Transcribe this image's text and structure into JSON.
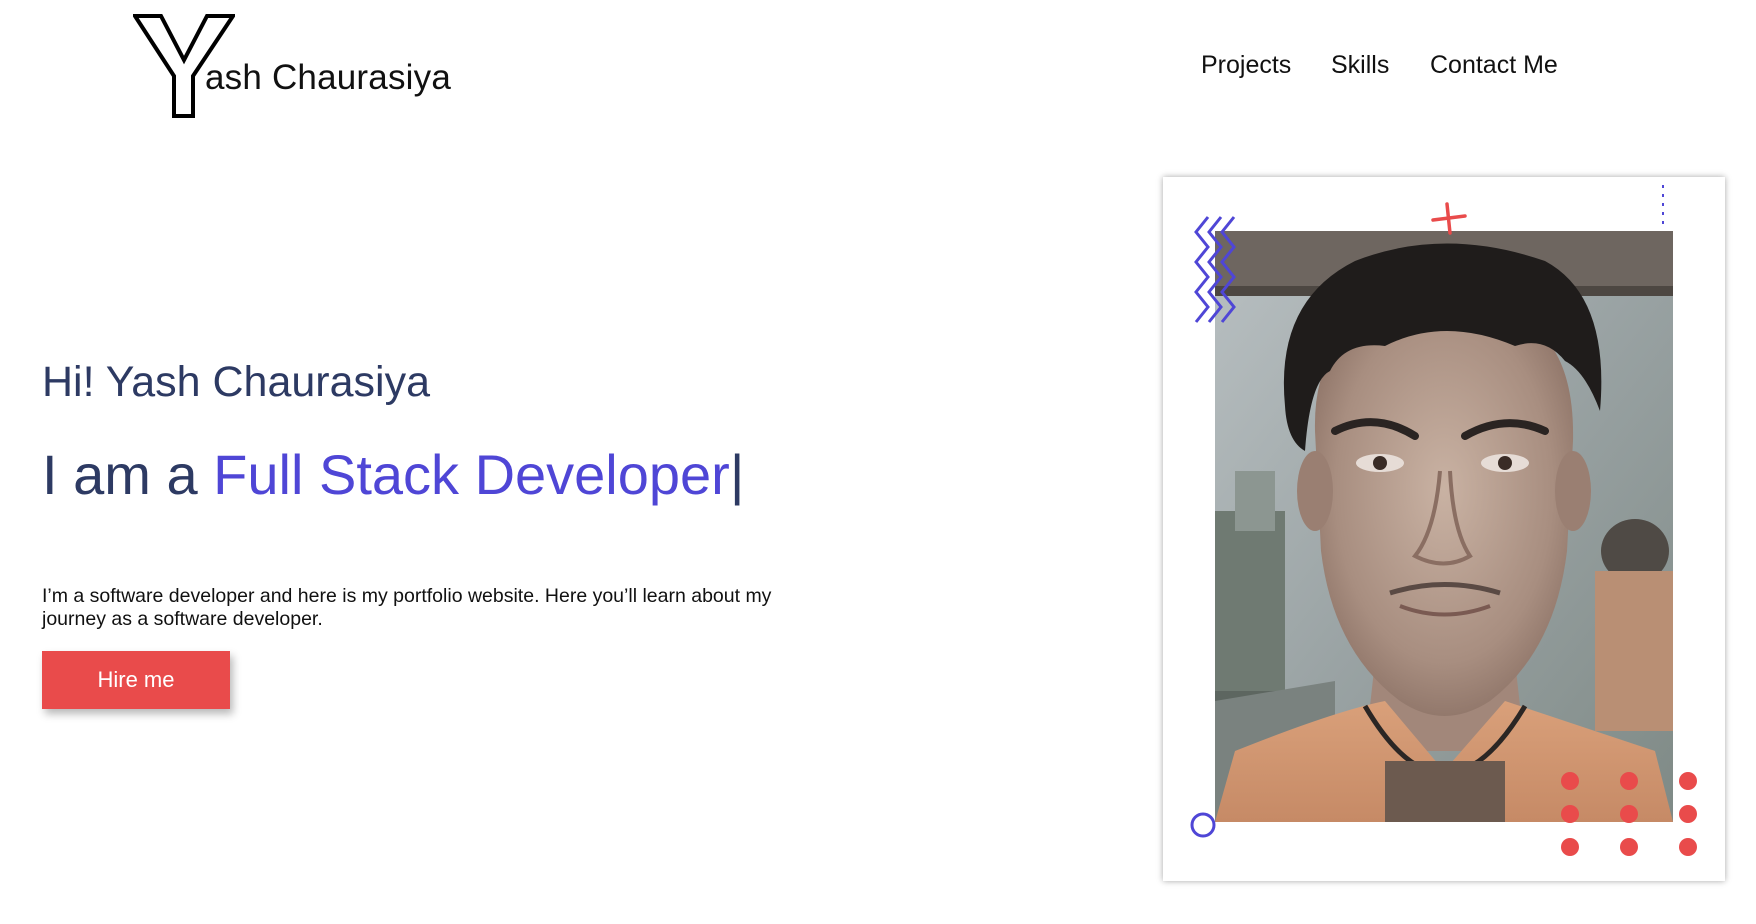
{
  "header": {
    "logo_letter": "Y",
    "logo_text": "ash Chaurasiya",
    "nav": [
      {
        "label": "Projects"
      },
      {
        "label": "Skills"
      },
      {
        "label": "Contact Me"
      }
    ]
  },
  "hero": {
    "greeting": "Hi! Yash Chaurasiya",
    "role_prefix": "I am a ",
    "role_highlight": "Full Stack Developer",
    "cursor": "|",
    "description": "I’m a software developer and here is my portfolio website. Here you’ll learn about my journey as a software developer.",
    "cta_label": "Hire me"
  },
  "colors": {
    "accent": "#4f46d6",
    "heading": "#2d3a63",
    "button": "#e94b4b",
    "decor_red": "#e94b4b"
  },
  "icons": [
    "zigzag-decor-icon",
    "plus-decor-icon",
    "circle-decor-icon",
    "dot-grid-decor-icon"
  ]
}
